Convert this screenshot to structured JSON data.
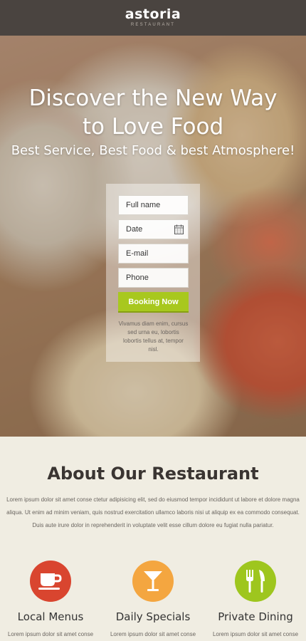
{
  "header": {
    "logo": "astoria",
    "logo_sub": "RESTAURANT"
  },
  "hero": {
    "title": "Discover the New Way to Love Food",
    "subtitle": "Best Service, Best Food & best Atmosphere!"
  },
  "booking": {
    "fields": [
      {
        "placeholder": "Full name"
      },
      {
        "placeholder": "Date",
        "icon": "calendar-icon"
      },
      {
        "placeholder": "E-mail"
      },
      {
        "placeholder": "Phone"
      }
    ],
    "button_label": "Booking Now",
    "note": "Vivamus diam enim, cursus sed urna eu, lobortis lobortis tellus at, tempor nisl.",
    "button_color": "#a8c81e"
  },
  "about": {
    "title": "About Our Restaurant",
    "text": "Lorem ipsum dolor sit amet conse ctetur adipisicing elit, sed do eiusmod tempor incididunt ut labore et dolore magna aliqua. Ut enim ad minim veniam, quis nostrud exercitation ullamco laboris nisi ut aliquip ex ea commodo consequat. Duis aute irure dolor in reprehenderit in voluptate velit esse cillum dolore eu fugiat nulla pariatur."
  },
  "features": [
    {
      "title": "Local Menus",
      "text": "Lorem ipsum dolor sit amet conse",
      "icon": "coffee-cup-icon",
      "color": "#d9452f"
    },
    {
      "title": "Daily Specials",
      "text": "Lorem ipsum dolor sit amet conse",
      "icon": "cocktail-glass-icon",
      "color": "#f4a640"
    },
    {
      "title": "Private Dining",
      "text": "Lorem ipsum dolor sit amet conse",
      "icon": "fork-knife-icon",
      "color": "#9ec61e"
    }
  ]
}
